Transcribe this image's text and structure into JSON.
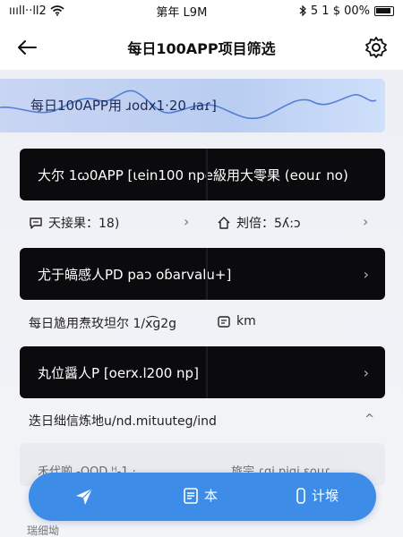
{
  "status_bar": {
    "signal_text": "ıııll··ll2",
    "carrier_time": "第年 L9M",
    "battery_text": "5 1 $ 00%"
  },
  "header": {
    "title": "每日100APP项目筛选"
  },
  "banner": {
    "text": "每日100APP用 ɹodx1·20 ɹaɾ]"
  },
  "card1": {
    "text": "大尔 1ꞷ0APP [ɩein100 npe級用大零果 (eouɾ no)"
  },
  "row1": {
    "left": "天接果：18)",
    "right": "刔倍：5ʎ:ɔ"
  },
  "card2": {
    "text": "尤于皜感人PD paɔ oɓarvalu+]"
  },
  "row2": {
    "left": "每日尯用焘玫坦尔 1/x͡ɡ2g",
    "right": "km"
  },
  "card3": {
    "text": "丸位醤人P [oerx.l200 np]"
  },
  "footer": {
    "text": "迭日绌信炼地u/nd.mituuteg/ind",
    "caret": "^"
  },
  "faded_card": {
    "left": "禾代啲 -OOD ᵸ-1 ·",
    "right": "旅宗 ɾɑi ɒiɑi ɛοuɾ"
  },
  "bottom_nav": {
    "tab1_label": "",
    "tab2_label": "本",
    "tab3_label": "计堠"
  },
  "bottom_text": "瑞细坳   "
}
